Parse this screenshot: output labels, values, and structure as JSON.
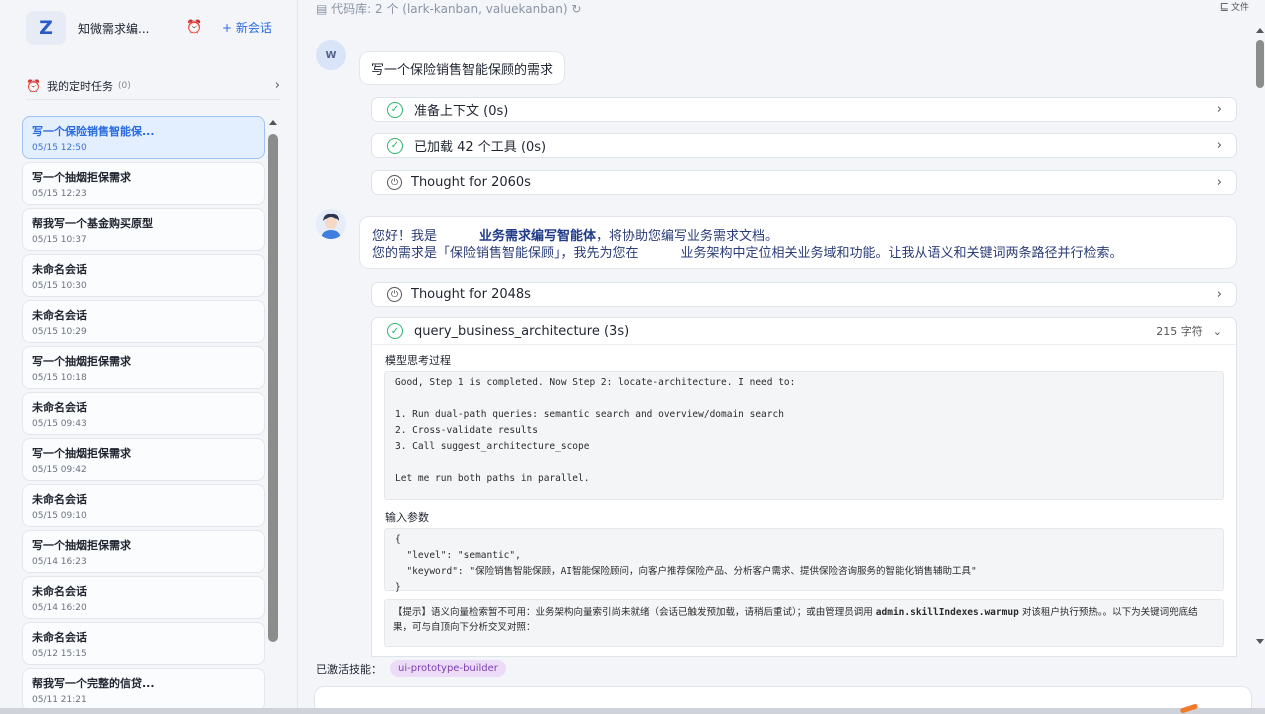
{
  "sidebar": {
    "brand_logo": "Z",
    "brand_name": "知微需求编...",
    "new_chat": "+ 新会话",
    "scheduled": {
      "label": "我的定时任务",
      "count": "(0)"
    },
    "conversations": [
      {
        "title": "写一个保险销售智能保...",
        "time": "05/15 12:50"
      },
      {
        "title": "写一个抽烟拒保需求",
        "time": "05/15 12:23"
      },
      {
        "title": "帮我写一个基金购买原型",
        "time": "05/15 10:37"
      },
      {
        "title": "未命名会话",
        "time": "05/15 10:30"
      },
      {
        "title": "未命名会话",
        "time": "05/15 10:29"
      },
      {
        "title": "写一个抽烟拒保需求",
        "time": "05/15 10:18"
      },
      {
        "title": "未命名会话",
        "time": "05/15 09:43"
      },
      {
        "title": "写一个抽烟拒保需求",
        "time": "05/15 09:42"
      },
      {
        "title": "未命名会话",
        "time": "05/15 09:10"
      },
      {
        "title": "写一个抽烟拒保需求",
        "time": "05/14 16:23"
      },
      {
        "title": "未命名会话",
        "time": "05/14 16:20"
      },
      {
        "title": "未命名会话",
        "time": "05/12 15:15"
      },
      {
        "title": "帮我写一个完整的信贷...",
        "time": "05/11 21:21"
      }
    ]
  },
  "header": {
    "repo": "代码库: 2 个 (lark-kanban, valuekanban)",
    "files": "文件"
  },
  "chat": {
    "user_avatar": "W",
    "user_message": "写一个保险销售智能保顾的需求",
    "steps_1": [
      {
        "label": "准备上下文 (0s)"
      },
      {
        "label": "已加载 42 个工具 (0s)"
      },
      {
        "label": "Thought for 2060s"
      }
    ],
    "bot_line1_prefix": "您好！我是",
    "bot_line1_bold": "业务需求编写智能体",
    "bot_line1_suffix": "，将协助您编写业务需求文档。",
    "bot_line2_prefix": "您的需求是「保险销售智能保顾」，我先为您在",
    "bot_line2_suffix": "业务架构中定位相关业务域和功能。让我从语义和关键词两条路径并行检索。",
    "thought_2": "Thought for 2048s",
    "tool": {
      "name": "query_business_architecture (3s)",
      "chars": "215 字符",
      "reasoning_label": "模型思考过程",
      "reasoning": "Good, Step 1 is completed. Now Step 2: locate-architecture. I need to:\n\n1. Run dual-path queries: semantic search and overview/domain search\n2. Cross-validate results\n3. Call suggest_architecture_scope\n\nLet me run both paths in parallel.",
      "params_label": "输入参数",
      "params": "{\n  \"level\": \"semantic\",\n  \"keyword\": \"保险销售智能保顾，AI智能保险顾问，向客户推荐保险产品、分析客户需求、提供保险咨询服务的智能化销售辅助工具\"\n}",
      "hint_prefix": "【提示】语义向量检索暂不可用：业务架构向量索引尚未就绪（会话已触发预加载，请稍后重试）；或由管理员调用",
      "hint_code": "admin.skillIndexes.warmup",
      "hint_suffix": "对该租户执行预热。。以下为关键词兜底结果，可与自顶向下分析交叉对照："
    }
  },
  "footer": {
    "skills_label": "已激活技能：",
    "skill": "ui-prototype-builder"
  }
}
